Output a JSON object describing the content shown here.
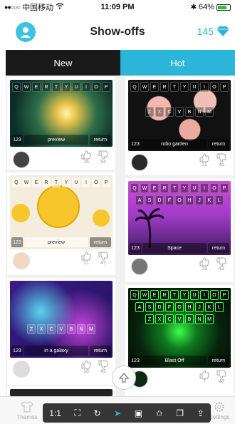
{
  "status": {
    "carrier": "中国移动",
    "time": "11:09 PM",
    "battery": "64%"
  },
  "header": {
    "title": "Show-offs",
    "coins": "145"
  },
  "tabs": [
    {
      "label": "New"
    },
    {
      "label": "Hot"
    }
  ],
  "cards": [
    {
      "bottom": "preview",
      "up": "16",
      "down": "54"
    },
    {
      "bottom": "robo garden",
      "up": "21",
      "down": "46"
    },
    {
      "bottom": "preview",
      "up": "21",
      "down": "47"
    },
    {
      "bottom": "Space",
      "up": "19",
      "down": "43"
    },
    {
      "bottom": "in a galaxy",
      "up": "18",
      "down": "42"
    },
    {
      "bottom": "Blast Off",
      "up": "7",
      "down": "48"
    }
  ],
  "keys": {
    "row1": [
      "Q",
      "W",
      "E",
      "R",
      "T",
      "Y",
      "U",
      "I",
      "O",
      "P"
    ],
    "row2": [
      "A",
      "S",
      "D",
      "F",
      "G",
      "H",
      "J",
      "K",
      "L"
    ],
    "row3": [
      "Z",
      "X",
      "C",
      "V",
      "B",
      "N",
      "M"
    ],
    "num": "123",
    "ret": "return"
  },
  "bottom_tabs": {
    "themes": "Themes",
    "settings": "Settings"
  },
  "toolbar": {
    "ratio": "1:1"
  }
}
